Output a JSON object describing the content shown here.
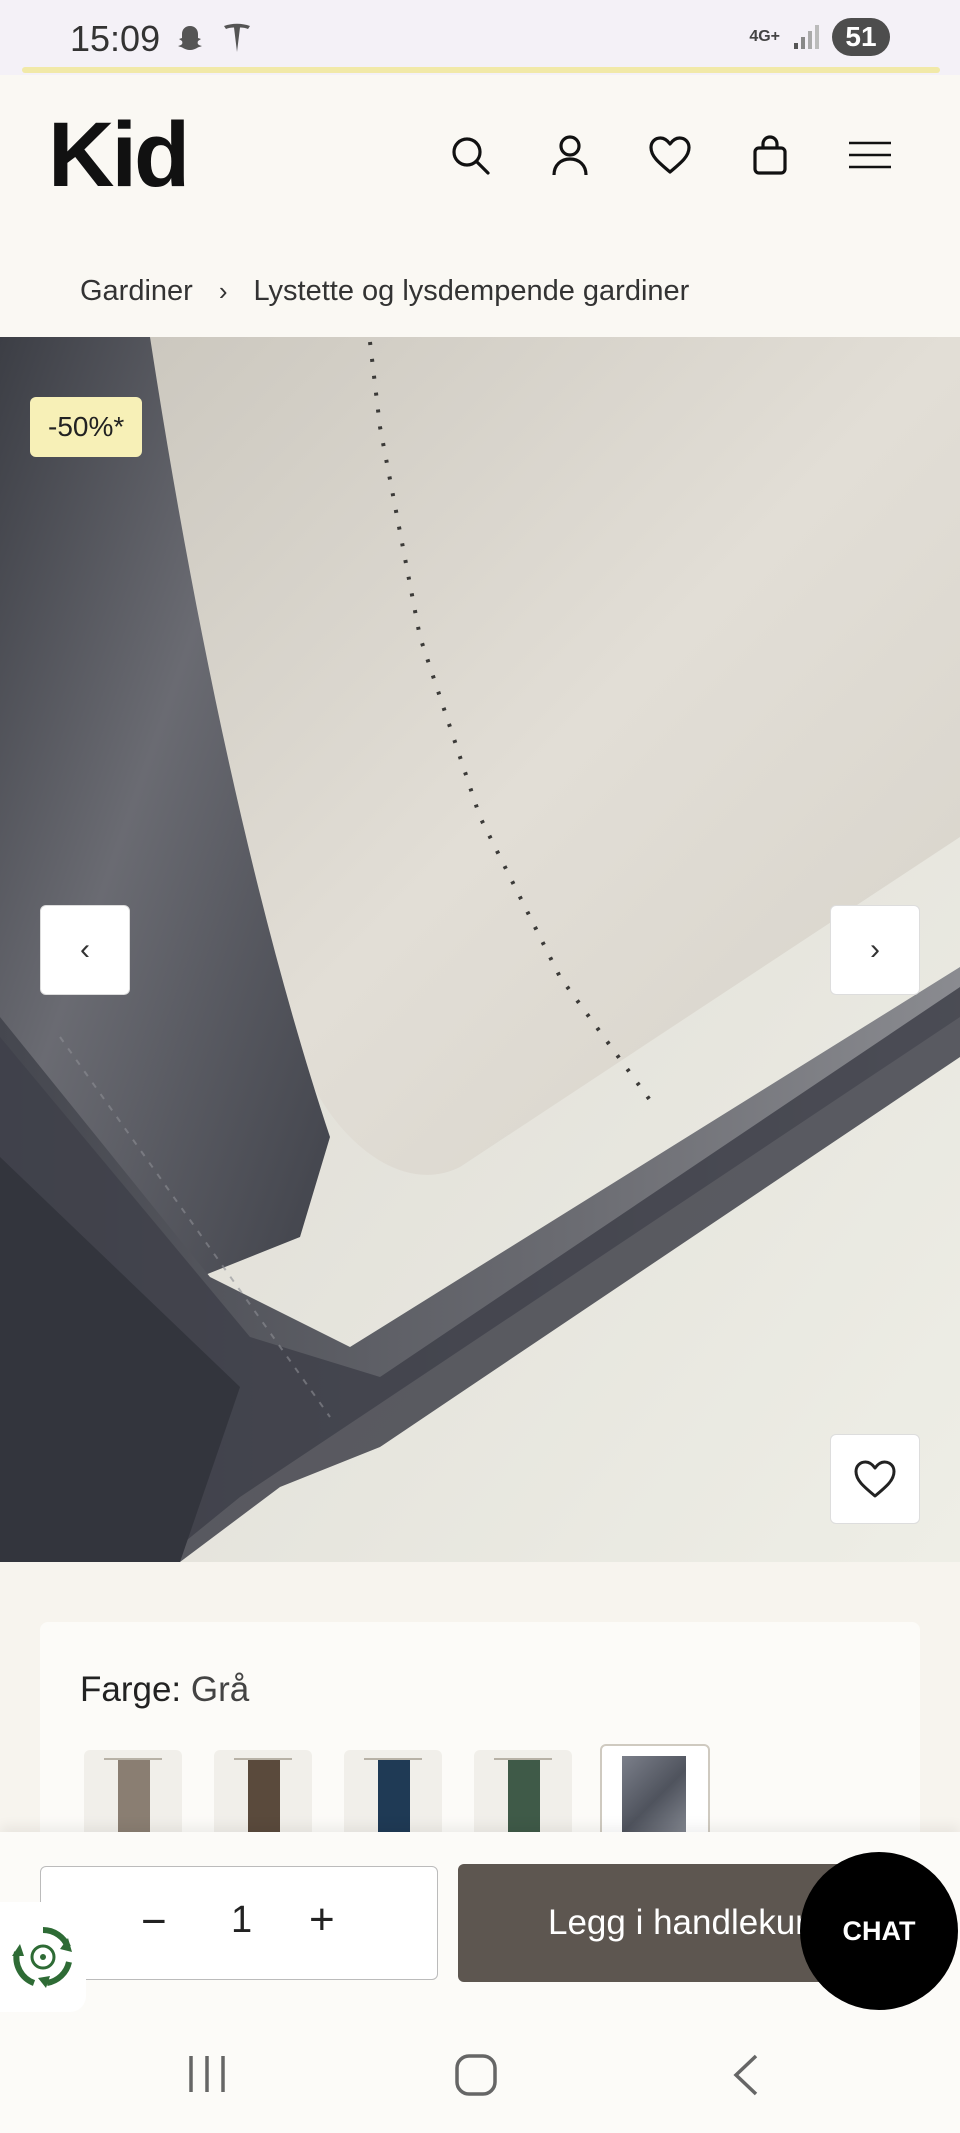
{
  "status_bar": {
    "time": "15:09",
    "network_label": "4G+",
    "battery": "51",
    "icons": [
      "snapchat-icon",
      "tesla-icon",
      "signal-icon"
    ]
  },
  "header": {
    "logo": "Kid",
    "icons": [
      "search-icon",
      "account-icon",
      "wishlist-heart-icon",
      "cart-bag-icon",
      "menu-icon"
    ]
  },
  "breadcrumb": {
    "items": [
      "Gardiner",
      "Lystette og lysdempende gardiner"
    ],
    "separator": "›"
  },
  "gallery": {
    "badge": "-50%*",
    "prev_label": "‹",
    "next_label": "›",
    "colors": {
      "dark_velvet": "#4a4c55",
      "lining": "#e4e0d8"
    }
  },
  "color_selector": {
    "label": "Farge:",
    "value": "Grå",
    "swatches": [
      {
        "name": "beige",
        "color": "#8a7e72"
      },
      {
        "name": "brown",
        "color": "#5a4a3c"
      },
      {
        "name": "navy",
        "color": "#1f3a55"
      },
      {
        "name": "green",
        "color": "#3f5a48"
      },
      {
        "name": "grey",
        "color": "#5e6370",
        "selected": true
      }
    ]
  },
  "purchase": {
    "quantity": "1",
    "minus_label": "−",
    "plus_label": "+",
    "add_to_cart": "Legg i handlekurv",
    "chat_label": "CHAT",
    "accent": "#5d5650"
  },
  "system_nav": {
    "icons": [
      "recents-icon",
      "home-icon",
      "back-icon"
    ]
  }
}
